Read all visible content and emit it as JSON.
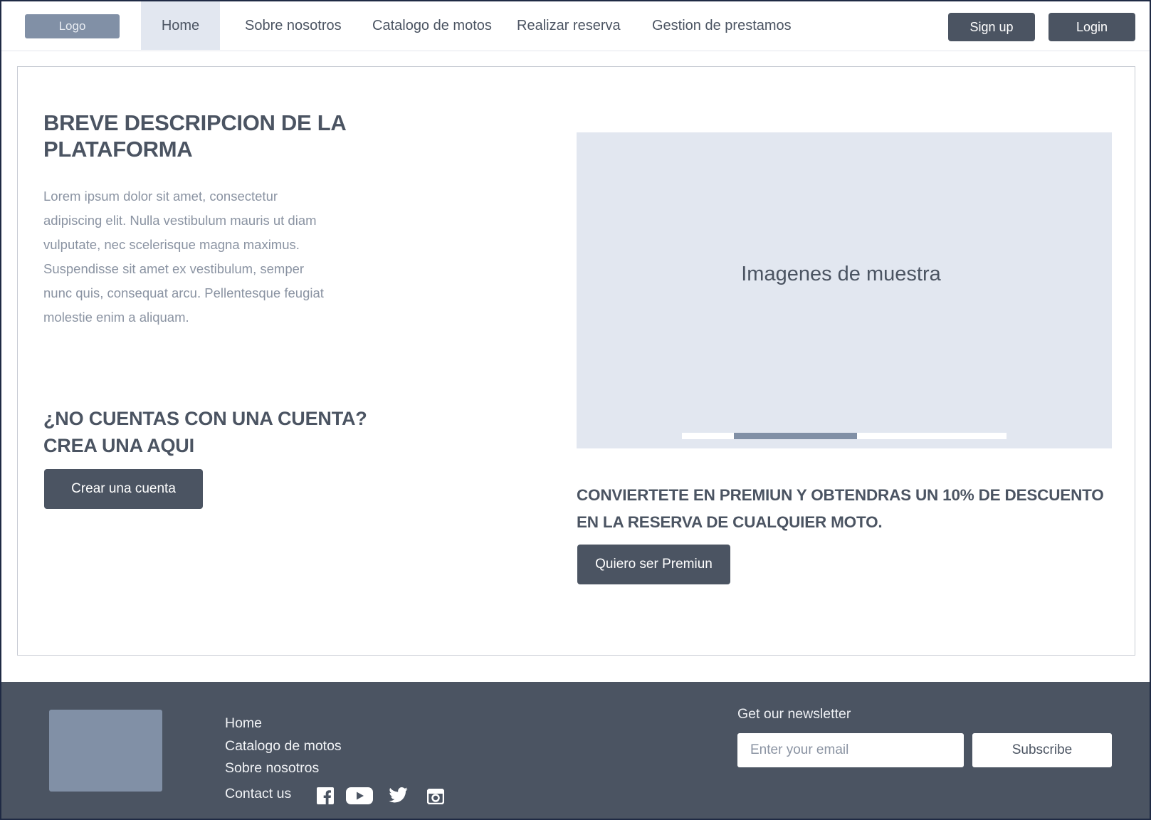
{
  "nav": {
    "logo": "Logo",
    "items": [
      {
        "label": "Home",
        "active": true
      },
      {
        "label": "Sobre nosotros",
        "active": false
      },
      {
        "label": "Catalogo de motos",
        "active": false
      },
      {
        "label": "Realizar reserva",
        "active": false
      },
      {
        "label": "Gestion de prestamos",
        "active": false
      }
    ],
    "signup": "Sign up",
    "login": "Login"
  },
  "main": {
    "title": "BREVE DESCRIPCION DE LA PLATAFORMA",
    "description": "Lorem ipsum dolor sit amet, consectetur adipiscing elit. Nulla vestibulum mauris ut diam vulputate, nec scelerisque magna maximus. Suspendisse sit amet ex vestibulum, semper nunc quis, consequat arcu. Pellentesque feugiat molestie enim a aliquam.",
    "no_account_line1": "¿NO CUENTAS CON UNA CUENTA?",
    "no_account_line2": "CREA UNA AQUI",
    "create_button": "Crear una cuenta",
    "slider_caption": "Imagenes de muestra",
    "slider_progress": {
      "start": 0.16,
      "end": 0.54
    },
    "premium_text": "CONVIERTETE EN PREMIUN Y OBTENDRAS UN 10% DE DESCUENTO EN LA RESERVA DE CUALQUIER MOTO.",
    "premium_button": "Quiero ser Premiun"
  },
  "footer": {
    "links": [
      "Home",
      "Catalogo de motos",
      "Sobre nosotros"
    ],
    "contact": "Contact us",
    "social": [
      "facebook-icon",
      "youtube-icon",
      "twitter-icon",
      "instagram-icon"
    ],
    "newsletter_label": "Get our newsletter",
    "email_placeholder": "Enter your email",
    "subscribe": "Subscribe"
  },
  "colors": {
    "dark": "#4b5462",
    "muted": "#8190a6",
    "light_panel": "#e2e7f0"
  }
}
